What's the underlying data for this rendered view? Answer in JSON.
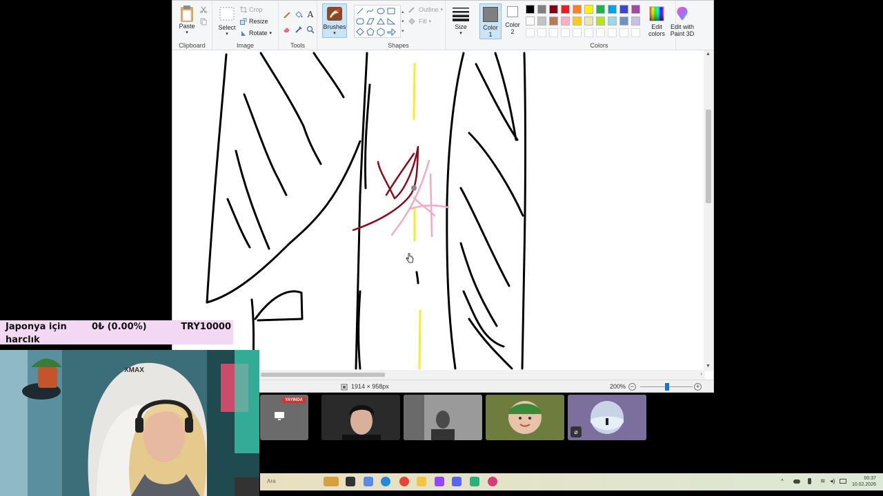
{
  "paint": {
    "clipboard": {
      "group_label": "Clipboard",
      "paste_label": "Paste"
    },
    "image": {
      "group_label": "Image",
      "select_label": "Select",
      "crop_label": "Crop",
      "resize_label": "Resize",
      "rotate_label": "Rotate"
    },
    "tools": {
      "group_label": "Tools"
    },
    "brushes": {
      "label": "Brushes"
    },
    "shapes": {
      "group_label": "Shapes",
      "outline_label": "Outline",
      "fill_label": "Fill"
    },
    "size_label": "Size",
    "color1_label": "Color 1",
    "color2_label": "Color 2",
    "colors": {
      "group_label": "Colors",
      "edit_colors_label": "Edit colors",
      "palette_row1": [
        "#000000",
        "#7f7f7f",
        "#880015",
        "#ed1c24",
        "#ff7f27",
        "#fff200",
        "#22b14c",
        "#00a2e8",
        "#3f48cc",
        "#a349a4"
      ],
      "palette_row2": [
        "#ffffff",
        "#c3c3c3",
        "#b97a57",
        "#ffaec9",
        "#ffc90e",
        "#efe4b0",
        "#b5e61d",
        "#99d9ea",
        "#7092be",
        "#c8bfe7"
      ]
    },
    "edit_with_paint3d_label": "Edit with Paint 3D",
    "status": {
      "dimensions": "1914 × 958px",
      "zoom": "200%"
    }
  },
  "overlay": {
    "donation": {
      "title": "Japonya için harclık",
      "progress": "0₺ (0.00%)",
      "goal": "TRY10000"
    },
    "live_badge": "YAYINDA"
  },
  "taskbar": {
    "search_placeholder": "Ara",
    "time": "00:37",
    "date": "10.02.2026"
  }
}
